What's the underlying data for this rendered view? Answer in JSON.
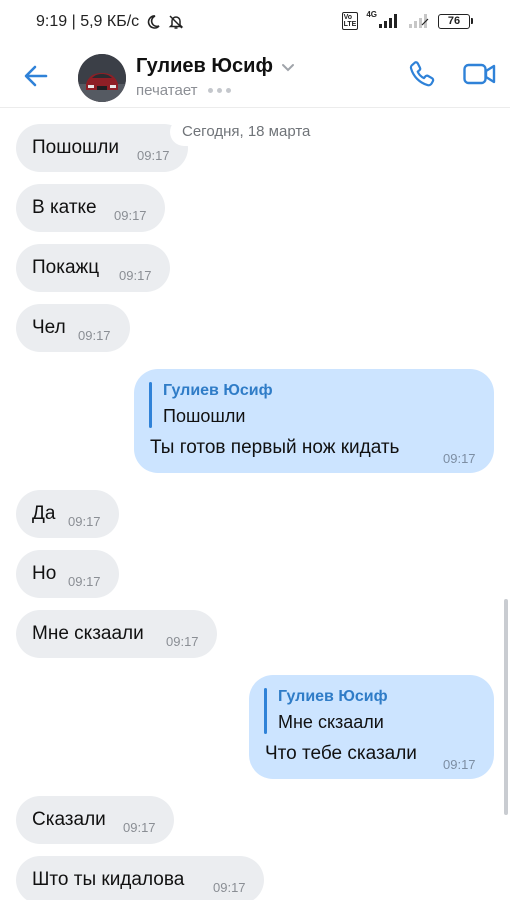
{
  "status_bar": {
    "left_text": "9:19 | 5,9 КБ/с",
    "net_badge": "4G",
    "tech_badge": "Vo\nLTE",
    "battery": "76"
  },
  "header": {
    "contact_name": "Гулиев Юсиф",
    "status": "печатает",
    "accent_color": "#2f82d8"
  },
  "chat": {
    "date_label": "Сегодня, 18 марта",
    "messages": [
      {
        "dir": "in",
        "text": "Пошошли",
        "time": "09:17"
      },
      {
        "dir": "in",
        "text": "В катке",
        "time": "09:17"
      },
      {
        "dir": "in",
        "text": "Покажц",
        "time": "09:17"
      },
      {
        "dir": "in",
        "text": "Чел",
        "time": "09:17"
      },
      {
        "dir": "out",
        "reply_name": "Гулиев Юсиф",
        "reply_text": "Пошошли",
        "text": "Ты готов первый нож кидать",
        "time": "09:17"
      },
      {
        "dir": "in",
        "text": "Да",
        "time": "09:17"
      },
      {
        "dir": "in",
        "text": "Но",
        "time": "09:17"
      },
      {
        "dir": "in",
        "text": "Мне скзаали",
        "time": "09:17"
      },
      {
        "dir": "out",
        "reply_name": "Гулиев Юсиф",
        "reply_text": "Мне скзаали",
        "text": "Что тебе сказали",
        "time": "09:17"
      },
      {
        "dir": "in",
        "text": "Сказали",
        "time": "09:17"
      },
      {
        "dir": "in",
        "text": "Што ты кидалова",
        "time": "09:17"
      }
    ]
  },
  "icons": {
    "back": "arrow-left-icon",
    "call": "phone-icon",
    "video": "video-camera-icon",
    "dropdown": "chevron-down-icon"
  }
}
